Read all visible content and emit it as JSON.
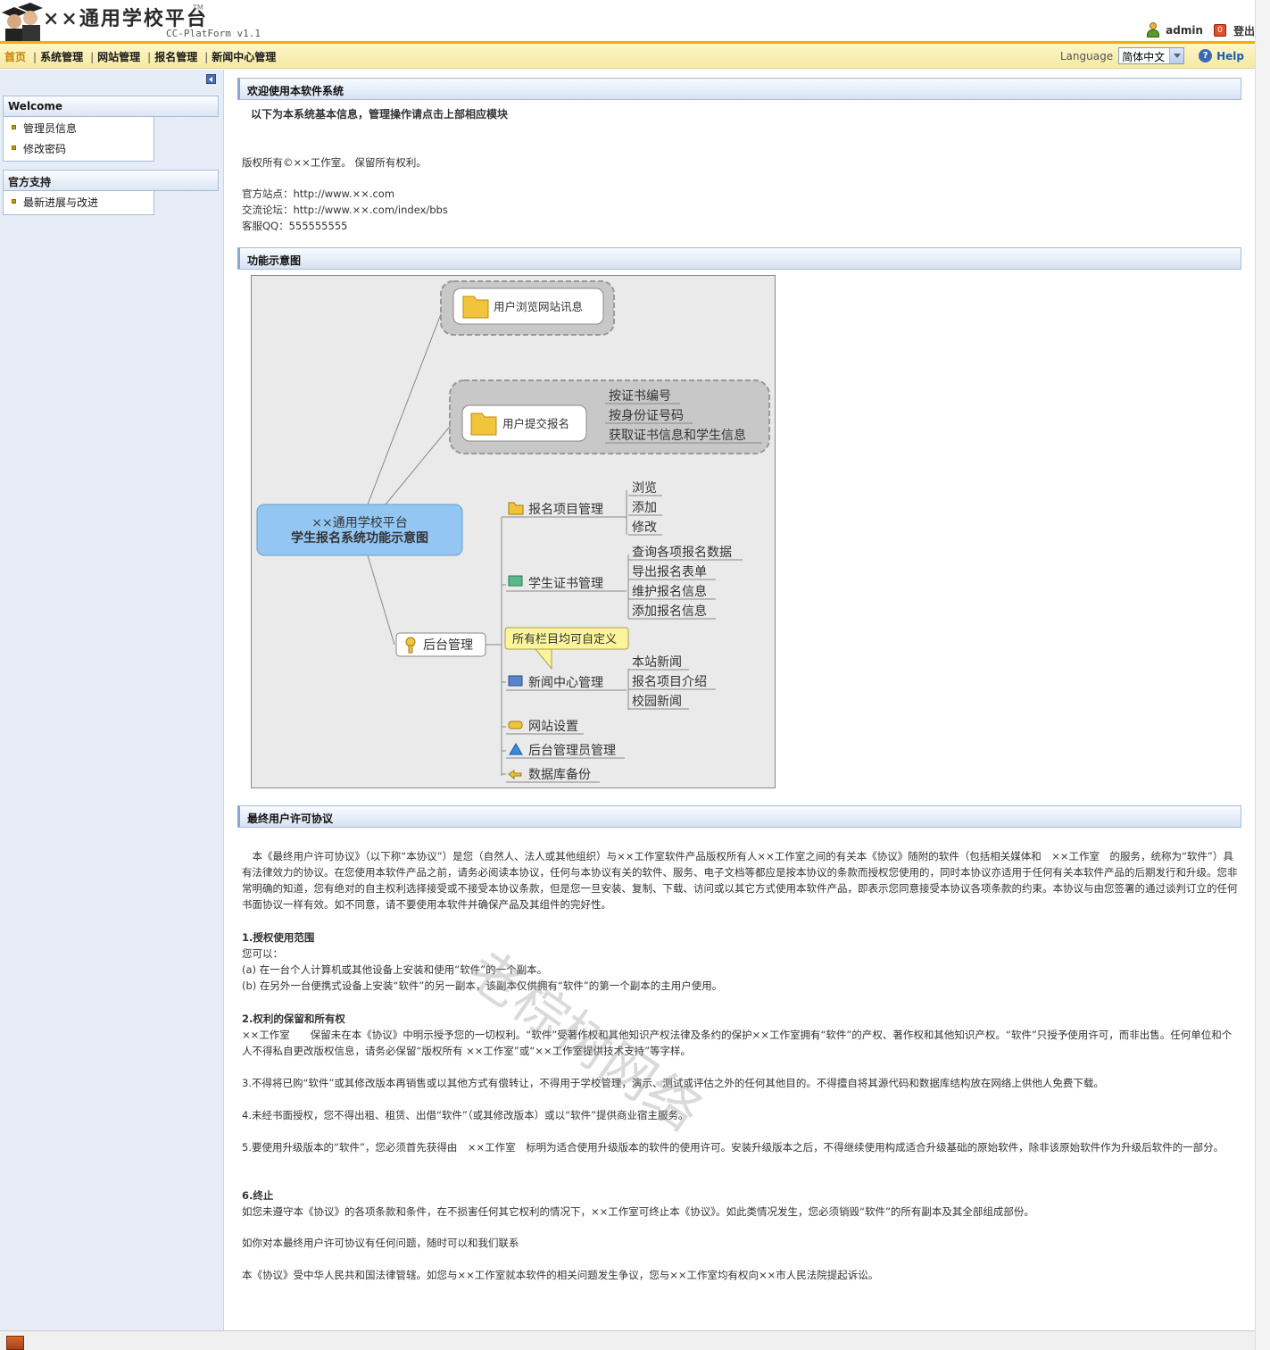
{
  "header": {
    "logo_title": "××通用学校平台",
    "logo_tm": "TM",
    "logo_sub": "CC-PlatForm v1.1",
    "user": "admin",
    "logout": "登出"
  },
  "nav": {
    "items": [
      "首页",
      "系统管理",
      "网站管理",
      "报名管理",
      "新闻中心管理"
    ],
    "language_label": "Language",
    "language_value": "简体中文",
    "help": "Help"
  },
  "sidebar": {
    "groups": [
      {
        "title": "Welcome",
        "items": [
          "管理员信息",
          "修改密码"
        ]
      },
      {
        "title": "官方支持",
        "items": [
          "最新进展与改进"
        ]
      }
    ]
  },
  "welcome": {
    "title": "欢迎使用本软件系统",
    "intro": "以下为本系统基本信息，管理操作请点击上部相应模块",
    "copyright": "版权所有©××工作室。 保留所有权利。",
    "site": "官方站点：http://www.××.com",
    "forum": "交流论坛：http://www.××.com/index/bbs",
    "qq": "客服QQ：555555555"
  },
  "diagram": {
    "title": "功能示意图",
    "root_line1": "××通用学校平台",
    "root_line2": "学生报名系统功能示意图",
    "browse_node": "用户浏览网站讯息",
    "submit_node": "用户提交报名",
    "submit_leaves": [
      "按证书编号",
      "按身份证号码",
      "获取证书信息和学生信息"
    ],
    "admin_node": "后台管理",
    "callout": "所有栏目均可自定义",
    "project": "报名项目管理",
    "project_leaves": [
      "浏览",
      "添加",
      "修改"
    ],
    "cert": "学生证书管理",
    "cert_leaves": [
      "查询各项报名数据",
      "导出报名表单",
      "维护报名信息",
      "添加报名信息"
    ],
    "news": "新闻中心管理",
    "news_leaves": [
      "本站新闻",
      "报名项目介绍",
      "校园新闻"
    ],
    "site_setting": "网站设置",
    "admin_users": "后台管理员管理",
    "backup": "数据库备份"
  },
  "license": {
    "title": "最终用户许可协议",
    "p1": "本《最终用户许可协议》（以下称“本协议”）是您（自然人、法人或其他组织）与××工作室软件产品版权所有人××工作室之间的有关本《协议》随附的软件（包括相关媒体和　××工作室　的服务，统称为“软件”）具有法律效力的协议。在您使用本软件产品之前，请务必阅读本协议，任何与本协议有关的软件、服务、电子文档等都应是按本协议的条款而授权您使用的，同时本协议亦适用于任何有关本软件产品的后期发行和升级。您非常明确的知道，您有绝对的自主权利选择接受或不接受本协议条款，但是您一旦安装、复制、下载、访问或以其它方式使用本软件产品，即表示您同意接受本协议各项条款的约束。本协议与由您签署的通过谈判订立的任何书面协议一样有效。如不同意，请不要使用本软件并确保产品及其组件的完好性。",
    "s1_title": "1.授权使用范围",
    "s1_l1": "您可以：",
    "s1_l2": "(a) 在一台个人计算机或其他设备上安装和使用“软件”的一个副本。",
    "s1_l3": "(b) 在另外一台便携式设备上安装“软件”的另一副本，该副本仅供拥有“软件”的第一个副本的主用户使用。",
    "s2_title": "2.权利的保留和所有权",
    "s2_body": "××工作室　　保留未在本《协议》中明示授予您的一切权利。“软件”受著作权和其他知识产权法律及条约的保护××工作室拥有“软件”的产权、著作权和其他知识产权。“软件”只授予使用许可，而非出售。任何单位和个人不得私自更改版权信息，请务必保留“版权所有 ××工作室”或“××工作室提供技术支持”等字样。",
    "s3": "3.不得将已购“软件”或其修改版本再销售或以其他方式有偿转让，不得用于学校管理，演示、测试或评估之外的任何其他目的。不得擅自将其源代码和数据库结构放在网络上供他人免费下载。",
    "s4": "4.未经书面授权，您不得出租、租赁、出借“软件”（或其修改版本）或以“软件”提供商业宿主服务。",
    "s5": "5.要使用升级版本的“软件”，您必须首先获得由　××工作室　标明为适合使用升级版本的软件的使用许可。安装升级版本之后，不得继续使用构成适合升级基础的原始软件，除非该原始软件作为升级后软件的一部分。",
    "s6_title": "6.终止",
    "s6_body": "如您未遵守本《协议》的各项条款和条件，在不损害任何其它权利的情况下，××工作室可终止本《协议》。如此类情况发生，您必须销毁“软件”的所有副本及其全部组成部份。",
    "contact": "如你对本最终用户许可协议有任何问题，随时可以和我们联系",
    "law": "本《协议》受中华人民共和国法律管辖。如您与××工作室就本软件的相关问题发生争议，您与××工作室均有权向××市人民法院提起诉讼。"
  },
  "watermark": "老棕树网络"
}
